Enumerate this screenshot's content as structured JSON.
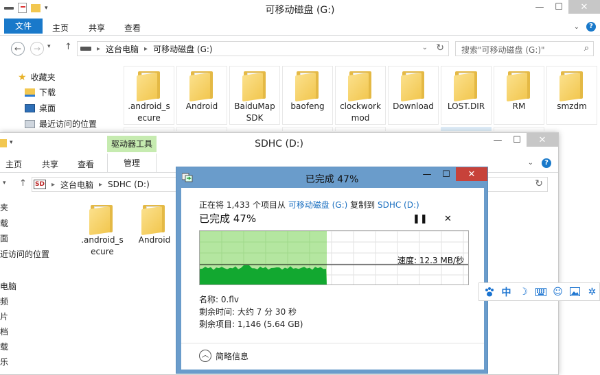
{
  "window1": {
    "title": "可移动磁盘 (G:)",
    "ribbon": {
      "file": "文件",
      "home": "主页",
      "share": "共享",
      "view": "查看"
    },
    "address": {
      "this_pc": "这台电脑",
      "drive": "可移动磁盘 (G:)"
    },
    "search_placeholder": "搜索\"可移动磁盘 (G:)\"",
    "nav": [
      {
        "label": "收藏夹",
        "icon": "star-icon"
      },
      {
        "label": "下载",
        "icon": "download-folder-icon"
      },
      {
        "label": "桌面",
        "icon": "desktop-icon"
      },
      {
        "label": "最近访问的位置",
        "icon": "recent-places-icon"
      }
    ],
    "files": [
      {
        "line1": ".android_s",
        "line2": "ecure"
      },
      {
        "line1": "Android",
        "line2": ""
      },
      {
        "line1": "BaiduMap",
        "line2": "SDK"
      },
      {
        "line1": "baofeng",
        "line2": ""
      },
      {
        "line1": "clockwork",
        "line2": "mod"
      },
      {
        "line1": "Download",
        "line2": ""
      },
      {
        "line1": "LOST.DIR",
        "line2": ""
      },
      {
        "line1": "RM",
        "line2": ""
      },
      {
        "line1": "smzdm",
        "line2": ""
      }
    ]
  },
  "window2": {
    "title": "SDHC (D:)",
    "context_tab": "驱动器工具",
    "ribbon": {
      "home": "主页",
      "share": "共享",
      "view": "查看",
      "manage": "管理"
    },
    "address": {
      "logo": "SD",
      "this_pc": "这台电脑",
      "drive": "SDHC (D:)"
    },
    "nav": [
      "夹",
      "载",
      "面",
      "近访问的位置",
      "",
      "电脑",
      "频",
      "片",
      "档",
      "载",
      "乐"
    ],
    "files": [
      {
        "line1": ".android_s",
        "line2": "ecure"
      },
      {
        "line1": "Android",
        "line2": ""
      }
    ]
  },
  "dialog": {
    "title": "已完成 47%",
    "status_prefix": "正在将 1,433 个项目从 ",
    "source": "可移动磁盘 (G:)",
    "status_mid": " 复制到 ",
    "dest": "SDHC (D:)",
    "percent_label": "已完成 47%",
    "progress": 0.47,
    "speed_label": "速度: 12.3 MB/秒",
    "name_label": "名称: 0.flv",
    "time_label": "剩余时间: 大约 7 分 30 秒",
    "items_label": "剩余项目: 1,146 (5.64 GB)",
    "details_toggle": "简略信息",
    "pause_symbol": "❚❚",
    "cancel_symbol": "✕"
  },
  "ime": {
    "icons": [
      "paw-icon",
      "chinese-mode-icon",
      "moon-icon",
      "keyboard-icon",
      "emoji-icon",
      "image-icon",
      "settings-icon"
    ],
    "mode": "中"
  },
  "colors": {
    "accent": "#1979ca",
    "dialog_frame": "#6a9ccb",
    "progress_fill": "#b4e6a0",
    "speed_fill": "#12a830",
    "close_red": "#c7423a",
    "context_tab": "#c6ebb0"
  }
}
